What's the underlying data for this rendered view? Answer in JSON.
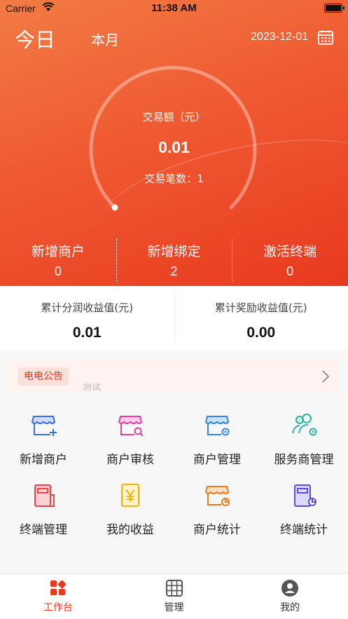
{
  "status_bar": {
    "carrier": "Carrier",
    "time": "11:38 AM"
  },
  "header": {
    "tab_today": "今日",
    "tab_month": "本月",
    "date": "2023-12-01"
  },
  "gauge": {
    "title": "交易额（元）",
    "value": "0.01",
    "count_text": "交易笔数：1"
  },
  "stats": [
    {
      "label": "新增商户",
      "value": "0"
    },
    {
      "label": "新增绑定",
      "value": "2"
    },
    {
      "label": "激活终端",
      "value": "0"
    }
  ],
  "earnings": [
    {
      "label": "累计分润收益值(元)",
      "value": "0.01"
    },
    {
      "label": "累计奖励收益值(元)",
      "value": "0.00"
    }
  ],
  "notice": {
    "tag": "电电公告",
    "text": "测试"
  },
  "menu": [
    {
      "label": "新增商户",
      "icon": "store-add-icon",
      "color": "#3a6fe0"
    },
    {
      "label": "商户审核",
      "icon": "store-search-icon",
      "color": "#e23ea6"
    },
    {
      "label": "商户管理",
      "icon": "store-settings-icon",
      "color": "#2f86e8"
    },
    {
      "label": "服务商管理",
      "icon": "users-settings-icon",
      "color": "#2bb3a4"
    },
    {
      "label": "终端管理",
      "icon": "terminal-icon",
      "color": "#e8454a"
    },
    {
      "label": "我的收益",
      "icon": "yen-receipt-icon",
      "color": "#f0b400"
    },
    {
      "label": "商户统计",
      "icon": "store-chart-icon",
      "color": "#ef7a1a"
    },
    {
      "label": "终端统计",
      "icon": "terminal-chart-icon",
      "color": "#5a4ed8"
    }
  ],
  "tabbar": [
    {
      "label": "工作台",
      "icon": "workbench-icon",
      "active": true
    },
    {
      "label": "管理",
      "icon": "grid-icon",
      "active": false
    },
    {
      "label": "我的",
      "icon": "user-icon",
      "active": false
    }
  ],
  "colors": {
    "accent": "#e8391f",
    "hero_start": "#f27b44",
    "hero_end": "#e8391f"
  }
}
